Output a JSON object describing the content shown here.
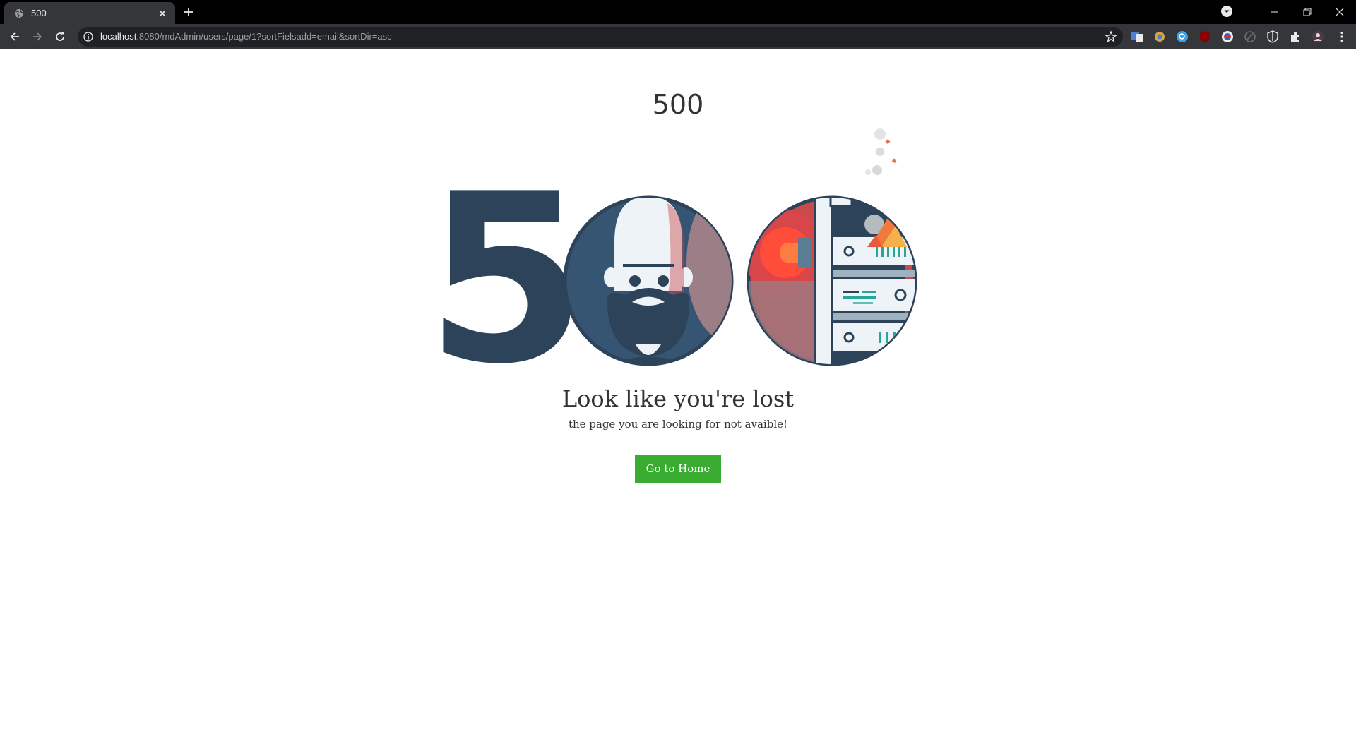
{
  "browser": {
    "tab_title": "500",
    "url_host": "localhost",
    "url_rest": ":8080/mdAdmin/users/page/1?sortFielsadd=email&sortDir=asc"
  },
  "page": {
    "code": "500",
    "illustration_digit": "5",
    "title": "Look like you're lost",
    "subtitle": "the page you are looking for not avaible!",
    "button_label": "Go to Home"
  },
  "colors": {
    "accent_green": "#39ac31",
    "illustration_navy": "#2c4359",
    "alarm_red": "#c84a4a",
    "server_teal": "#2aa59a",
    "fire_orange": "#f07a3c"
  }
}
